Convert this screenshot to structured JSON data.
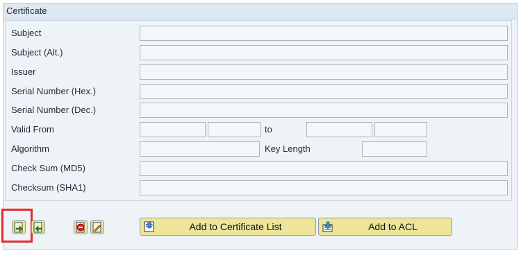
{
  "group_title": "Certificate",
  "fields": {
    "subject_label": "Subject",
    "subject_alt_label": "Subject (Alt.)",
    "issuer_label": "Issuer",
    "serial_hex_label": "Serial Number (Hex.)",
    "serial_dec_label": "Serial Number (Dec.)",
    "valid_from_label": "Valid From",
    "valid_to_label": "to",
    "algorithm_label": "Algorithm",
    "key_length_label": "Key Length",
    "checksum_md5_label": "Check Sum (MD5)",
    "checksum_sha1_label": "Checksum (SHA1)"
  },
  "buttons": {
    "add_to_certificate_list": "Add to Certificate List",
    "add_to_acl": "Add to ACL"
  },
  "icons": {
    "import": "import-certificate-icon",
    "export": "export-certificate-icon",
    "delete": "delete-icon",
    "change": "change-icon"
  },
  "colors": {
    "button_bg": "#ece59a",
    "panel_bg": "#eef3f8",
    "highlight": "#e32b2b"
  }
}
